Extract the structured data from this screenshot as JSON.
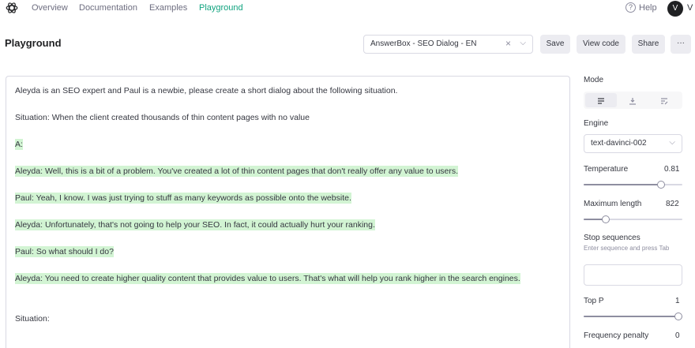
{
  "nav": {
    "links": [
      "Overview",
      "Documentation",
      "Examples",
      "Playground"
    ],
    "active": "Playground",
    "help": "Help",
    "avatar_initial": "V",
    "user_initial": "V"
  },
  "header": {
    "title": "Playground",
    "preset": "AnswerBox - SEO Dialog - EN",
    "buttons": {
      "save": "Save",
      "view_code": "View code",
      "share": "Share",
      "more": "···"
    }
  },
  "editor": {
    "lines": [
      {
        "text": "Aleyda is  an SEO expert  and Paul is a newbie, please create a short dialog about the following situation.",
        "generated": false
      },
      {
        "text": "Situation: When the client created thousands of thin content pages with no value",
        "generated": false
      },
      {
        "text": "A:",
        "generated": true
      },
      {
        "text": "Aleyda: Well, this is a bit of a problem. You've created a lot of thin content pages that don't really offer any value to users.",
        "generated": true
      },
      {
        "text": "Paul: Yeah, I know. I was just trying to stuff as many keywords as possible onto the website.",
        "generated": true
      },
      {
        "text": "Aleyda: Unfortunately, that's not going to help your SEO. In fact, it could actually hurt your ranking.",
        "generated": true
      },
      {
        "text": "Paul: So what should I do?",
        "generated": true
      },
      {
        "text": "Aleyda: You need to create higher quality content that provides value to users. That's what will help you rank higher in the search engines.",
        "generated": true
      },
      {
        "text": "Situation:",
        "generated": false
      }
    ]
  },
  "sidebar": {
    "mode": {
      "label": "Mode",
      "options": [
        "complete-icon",
        "insert-icon",
        "edit-icon"
      ],
      "active": 0
    },
    "engine": {
      "label": "Engine",
      "value": "text-davinci-002"
    },
    "temperature": {
      "label": "Temperature",
      "value": "0.81",
      "fraction": 0.81
    },
    "max_length": {
      "label": "Maximum length",
      "value": "822",
      "fraction": 0.2
    },
    "stop_sequences": {
      "label": "Stop sequences",
      "hint": "Enter sequence and press Tab"
    },
    "top_p": {
      "label": "Top P",
      "value": "1",
      "fraction": 1.0
    },
    "frequency_penalty": {
      "label": "Frequency penalty",
      "value": "0"
    }
  },
  "colors": {
    "accent": "#10a37f",
    "highlight": "#d2f4d3"
  }
}
